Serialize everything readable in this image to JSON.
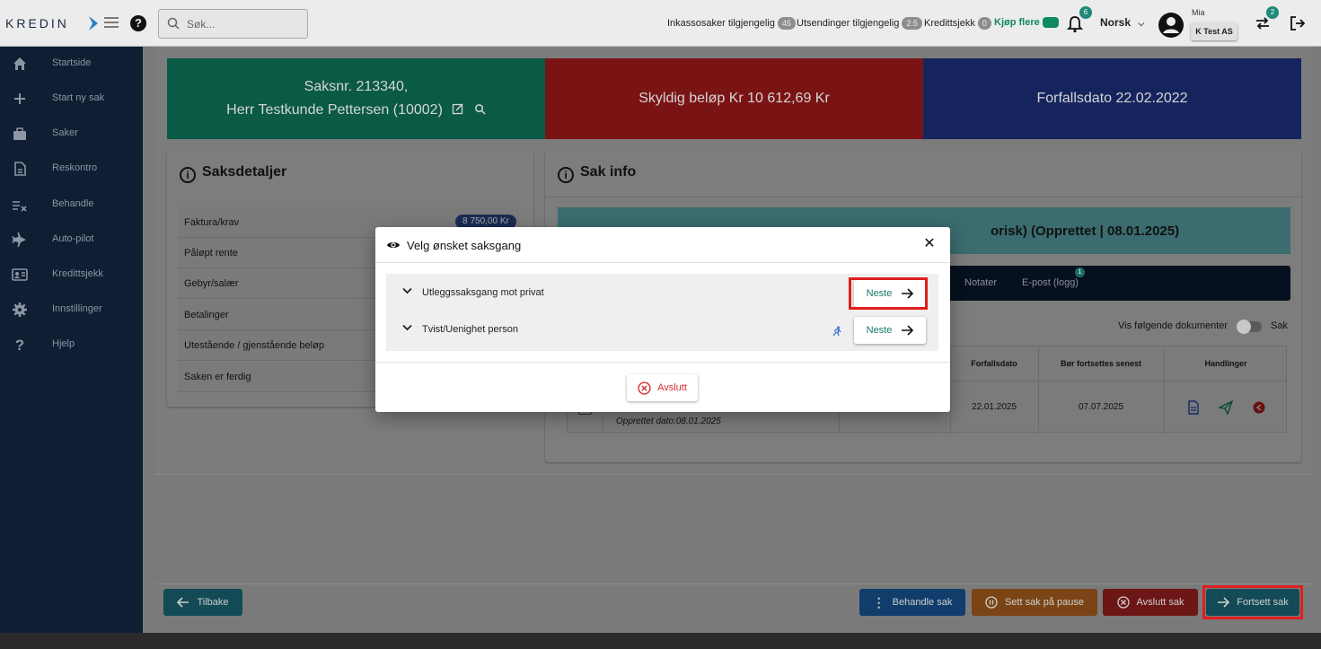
{
  "header": {
    "search_placeholder": "Søk...",
    "stats": [
      {
        "label": "Inkassosaker tilgjengelig",
        "count": "45"
      },
      {
        "label": "Utsendinger tilgjengelig",
        "count": "2.5"
      },
      {
        "label": "Kredittsjekk",
        "count": "0"
      }
    ],
    "buy_more": "Kjøp flere",
    "notifications_count": "6",
    "language": "Norsk",
    "user_name": "Mia",
    "company": "K Test AS",
    "swap_count": "2",
    "brand_color": "#17786a"
  },
  "sidebar": {
    "items": [
      {
        "label": "Startside",
        "icon": "home-icon"
      },
      {
        "label": "Start ny sak",
        "icon": "plus-icon"
      },
      {
        "label": "Saker",
        "icon": "briefcase-icon"
      },
      {
        "label": "Reskontro",
        "icon": "document-icon"
      },
      {
        "label": "Behandle",
        "icon": "checklist-icon"
      },
      {
        "label": "Auto-pilot",
        "icon": "airplane-icon"
      },
      {
        "label": "Kredittsjekk",
        "icon": "id-card-icon"
      },
      {
        "label": "Innstillinger",
        "icon": "gear-icon"
      },
      {
        "label": "Hjelp",
        "icon": "question-icon"
      }
    ]
  },
  "hero": {
    "case_line1": "Saksnr. 213340,",
    "case_line2": "Herr Testkunde Pettersen (10002)",
    "owed_label": "Skyldig beløp Kr 10 612,69 Kr",
    "due_label": "Forfallsdato",
    "due_value": "22.02.2022",
    "colors": {
      "case": "#0a5a45",
      "owed": "#7a1414",
      "due": "#16245e"
    }
  },
  "details": {
    "title": "Saksdetaljer",
    "rows": [
      "Faktura/krav",
      "Påløpt rente",
      "Gebyr/salær",
      "Betalinger",
      "Utestående / gjenstående beløp",
      "Saken er ferdig"
    ],
    "invoice_amount": "8 750,00 Kr"
  },
  "sakinfo": {
    "title": "Sak info",
    "banner_visible": "orisk) (Opprettet | 08.01.2025)",
    "tabs": [
      "Notater",
      "E-post (logg)"
    ],
    "email_badge": "1",
    "view_docs_label": "Vis følgende dokumenter",
    "toggle_label": "Sak",
    "table": {
      "headers": [
        "Forfallsdato",
        "Bør fortsettes senest",
        "Handlinger"
      ],
      "created": "Opprettet dato:08.01.2025",
      "due": "22.01.2025",
      "continue_by": "07.07.2025"
    }
  },
  "footer": {
    "back": "Tilbake",
    "handle": "Behandle sak",
    "pause": "Sett sak på pause",
    "close": "Avslutt sak",
    "continue": "Fortsett sak"
  },
  "dialog": {
    "title": "Velg ønsket saksgang",
    "options": [
      {
        "label": "Utleggssaksgang mot privat",
        "button": "Neste"
      },
      {
        "label": "Tvist/Uenighet person",
        "button": "Neste"
      }
    ],
    "cancel": "Avslutt"
  }
}
